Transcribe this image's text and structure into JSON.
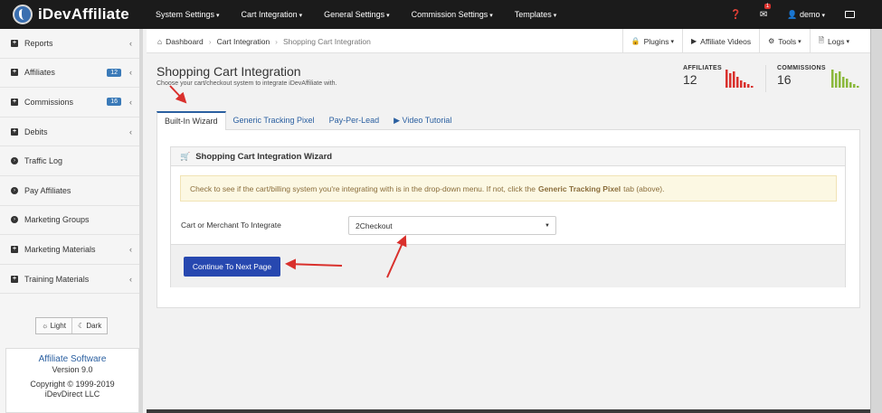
{
  "app": {
    "logo_text": "iDevAffiliate"
  },
  "topnav": {
    "menu": [
      {
        "label": "System Settings"
      },
      {
        "label": "Cart Integration"
      },
      {
        "label": "General Settings"
      },
      {
        "label": "Commission Settings"
      },
      {
        "label": "Templates"
      }
    ],
    "caret": "▾",
    "mail_badge": "1",
    "user": "demo"
  },
  "sidebar": {
    "items": [
      {
        "label": "Reports",
        "icon": "plus-square-icon",
        "badge": "",
        "chevron": "‹"
      },
      {
        "label": "Affiliates",
        "icon": "plus-square-icon",
        "badge": "12",
        "chevron": "‹"
      },
      {
        "label": "Commissions",
        "icon": "plus-square-icon",
        "badge": "16",
        "chevron": "‹"
      },
      {
        "label": "Debits",
        "icon": "plus-square-icon",
        "badge": "",
        "chevron": "‹"
      },
      {
        "label": "Traffic Log",
        "icon": "circle-arrow-icon",
        "badge": "",
        "chevron": ""
      },
      {
        "label": "Pay Affiliates",
        "icon": "circle-arrow-icon",
        "badge": "",
        "chevron": ""
      },
      {
        "label": "Marketing Groups",
        "icon": "circle-arrow-icon",
        "badge": "",
        "chevron": ""
      },
      {
        "label": "Marketing Materials",
        "icon": "plus-square-icon",
        "badge": "",
        "chevron": "‹"
      },
      {
        "label": "Training Materials",
        "icon": "plus-square-icon",
        "badge": "",
        "chevron": "‹"
      }
    ],
    "theme": {
      "light": "Light",
      "dark": "Dark"
    },
    "info": {
      "title": "Affiliate Software",
      "version": "Version 9.0",
      "copyright": "Copyright © 1999-2019",
      "company": "iDevDirect LLC"
    }
  },
  "breadcrumb": {
    "items": [
      "Dashboard",
      "Cart Integration",
      "Shopping Cart Integration"
    ],
    "buttons": [
      {
        "label": "Plugins",
        "icon": "lock-icon",
        "caret": true
      },
      {
        "label": "Affiliate Videos",
        "icon": "play-circle-icon",
        "caret": false
      },
      {
        "label": "Tools",
        "icon": "gear-icon",
        "caret": true
      },
      {
        "label": "Logs",
        "icon": "file-icon",
        "caret": true
      }
    ]
  },
  "page": {
    "title": "Shopping Cart Integration",
    "subtitle": "Choose your cart/checkout system to integrate iDevAffiliate with."
  },
  "stats": {
    "affiliates": {
      "label": "AFFILIATES",
      "value": "12",
      "color": "#d9302c",
      "sparkline": [
        10,
        8,
        9,
        6,
        4,
        3,
        2,
        1
      ]
    },
    "commissions": {
      "label": "COMMISSIONS",
      "value": "16",
      "color": "#8ab83a",
      "sparkline": [
        10,
        8,
        9,
        6,
        5,
        3,
        2,
        1
      ]
    }
  },
  "tabs": [
    {
      "label": "Built-In Wizard",
      "active": true
    },
    {
      "label": "Generic Tracking Pixel",
      "active": false
    },
    {
      "label": "Pay-Per-Lead",
      "active": false
    },
    {
      "label": "▶ Video Tutorial",
      "active": false
    }
  ],
  "wizard": {
    "title": "Shopping Cart Integration Wizard",
    "alert_before": "Check to see if the cart/billing system you're integrating with is in the drop-down menu. If not, click the",
    "alert_bold": "Generic Tracking Pixel",
    "alert_after": "tab (above).",
    "field_label": "Cart or Merchant To Integrate",
    "selected_cart": "2Checkout",
    "continue_label": "Continue To Next Page"
  },
  "colors": {
    "accent": "#2748b0",
    "link": "#2a5fa0",
    "annotation": "#d9302c"
  }
}
